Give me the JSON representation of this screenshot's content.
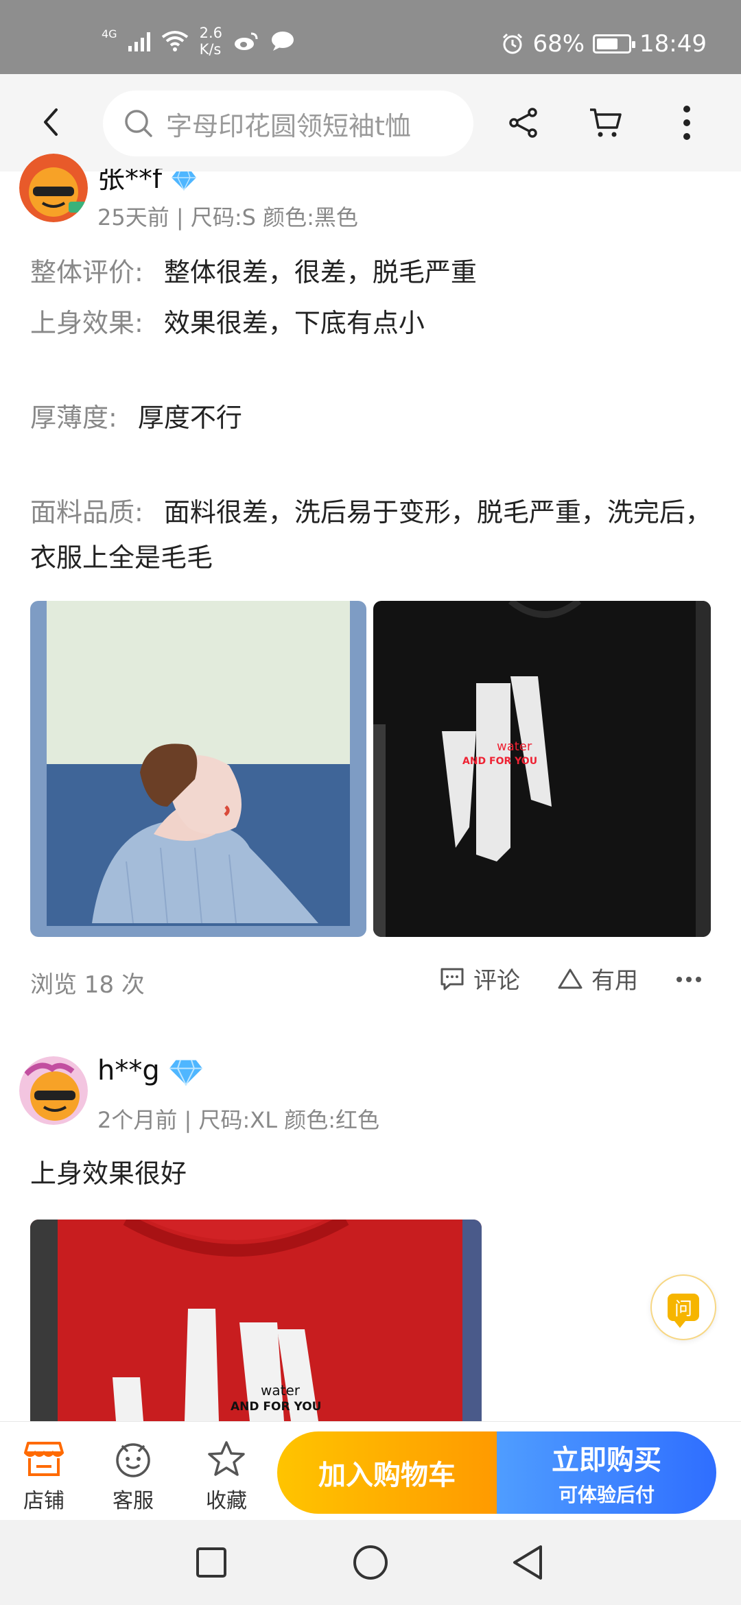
{
  "status_bar": {
    "network": "4G",
    "speed_value": "2.6",
    "speed_unit": "K/s",
    "battery": "68%",
    "time": "18:49"
  },
  "top_nav": {
    "search_text": "字母印花圆领短袖t恤",
    "icons": [
      "back-icon",
      "search-icon",
      "share-icon",
      "cart-icon",
      "more-vertical-icon"
    ]
  },
  "reviews": [
    {
      "username": "张**f",
      "meta": "25天前 | 尺码:S 颜色:黑色",
      "fields": [
        {
          "label": "整体评价:",
          "value": "整体很差，很差，脱毛严重"
        },
        {
          "label": "上身效果:",
          "value": "效果很差，下底有点小"
        },
        {
          "label": "厚薄度:",
          "value": "厚度不行"
        },
        {
          "label": "面料品质:",
          "value": "面料很差，洗后易于变形，脱毛严重，洗完后，衣服上全是毛毛"
        }
      ],
      "photo_texts": [
        "water",
        "AND FOR YOU"
      ],
      "views": "浏览 18 次",
      "actions": {
        "comment": "评论",
        "useful": "有用"
      }
    },
    {
      "username": "h**g",
      "meta": "2个月前 | 尺码:XL 颜色:红色",
      "text": "上身效果很好",
      "photo_texts": [
        "water",
        "AND FOR YOU"
      ]
    }
  ],
  "ask_button": "问",
  "bottom_bar": {
    "shop": "店铺",
    "service": "客服",
    "favorite": "收藏",
    "add_to_cart": "加入购物车",
    "buy_now": "立即购买",
    "buy_now_sub": "可体验后付"
  },
  "colors": {
    "status_bar": "#8e8e8e",
    "shop_orange": "#ff6a00",
    "cart_gradient_start": "#ffc400",
    "cart_gradient_end": "#ff9a00",
    "buy_gradient_start": "#4f9dff",
    "buy_gradient_end": "#2f6eff",
    "diamond_blue": "#4fb6ff"
  }
}
